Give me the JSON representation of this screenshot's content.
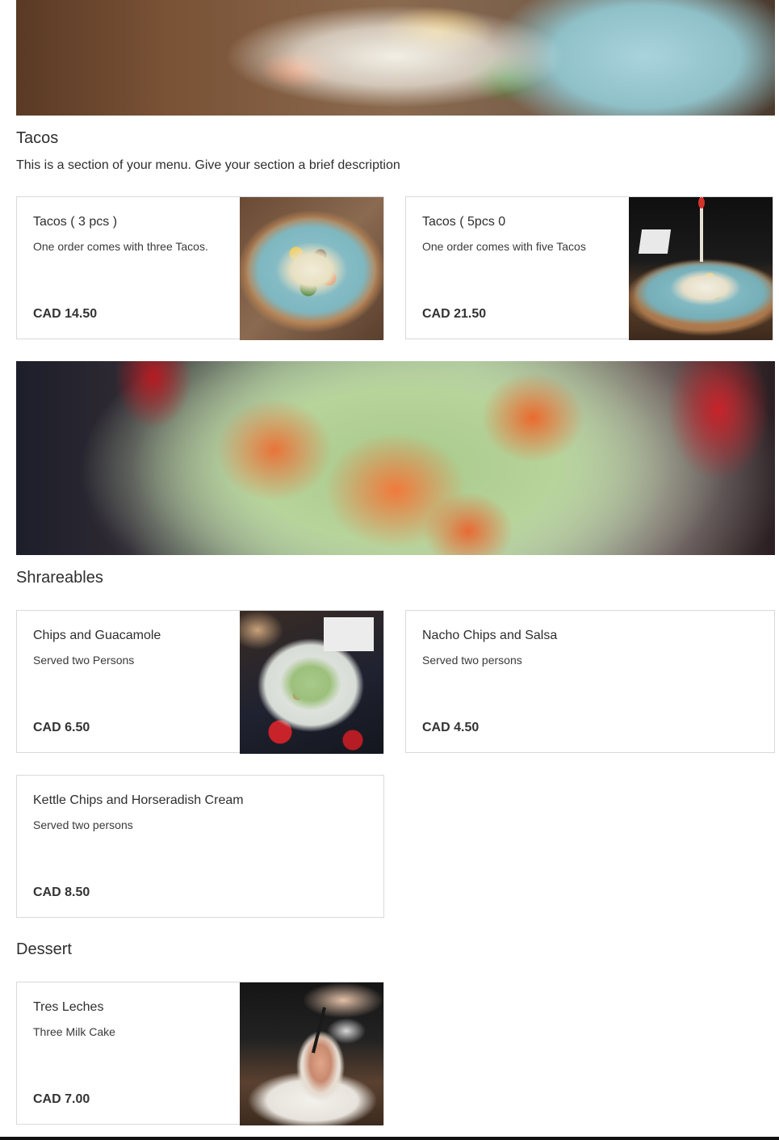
{
  "sections": [
    {
      "title": "Tacos",
      "description": "This is a section of your menu. Give your section a brief description",
      "items": [
        {
          "name": "Tacos ( 3 pcs )",
          "description": "One order comes with three Tacos.",
          "price": "CAD 14.50",
          "has_image": true
        },
        {
          "name": "Tacos ( 5pcs 0",
          "description": "One order comes with five Tacos",
          "price": "CAD 21.50",
          "has_image": true
        }
      ]
    },
    {
      "title": "Shrareables",
      "items": [
        {
          "name": "Chips and Guacamole",
          "description": "Served two Persons",
          "price": "CAD 6.50",
          "has_image": true
        },
        {
          "name": "Nacho Chips and Salsa",
          "description": "Served two persons",
          "price": "CAD 4.50",
          "has_image": false
        },
        {
          "name": "Kettle Chips and Horseradish Cream",
          "description": "Served two persons",
          "price": "CAD 8.50",
          "has_image": false
        }
      ]
    },
    {
      "title": "Dessert",
      "items": [
        {
          "name": "Tres Leches",
          "description": "Three Milk Cake",
          "price": "CAD 7.00",
          "has_image": true
        }
      ]
    }
  ]
}
